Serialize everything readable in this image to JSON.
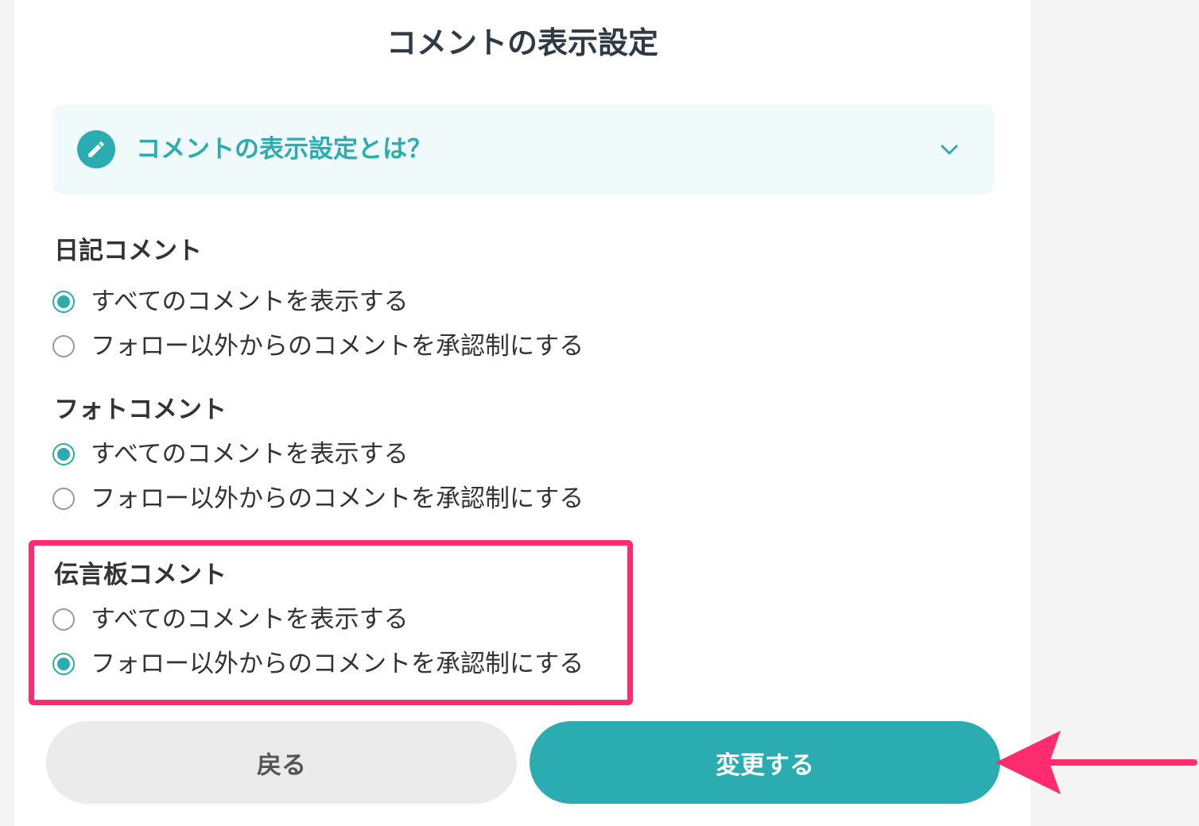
{
  "page": {
    "title": "コメントの表示設定"
  },
  "accordion": {
    "title": "コメントの表示設定とは？",
    "icon": "pencil-icon",
    "chevron": "chevron-down-icon"
  },
  "sections": [
    {
      "label": "日記コメント",
      "options": [
        {
          "label": "すべてのコメントを表示する",
          "checked": true
        },
        {
          "label": "フォロー以外からのコメントを承認制にする",
          "checked": false
        }
      ]
    },
    {
      "label": "フォトコメント",
      "options": [
        {
          "label": "すべてのコメントを表示する",
          "checked": true
        },
        {
          "label": "フォロー以外からのコメントを承認制にする",
          "checked": false
        }
      ]
    },
    {
      "label": "伝言板コメント",
      "options": [
        {
          "label": "すべてのコメントを表示する",
          "checked": false
        },
        {
          "label": "フォロー以外からのコメントを承認制にする",
          "checked": true
        }
      ]
    }
  ],
  "buttons": {
    "back_label": "戻る",
    "submit_label": "変更する"
  },
  "colors": {
    "accent": "#2aacb1",
    "accordion_bg": "#f1fafa",
    "highlight": "#ff2d6f",
    "back_button_bg": "#ebebeb"
  }
}
